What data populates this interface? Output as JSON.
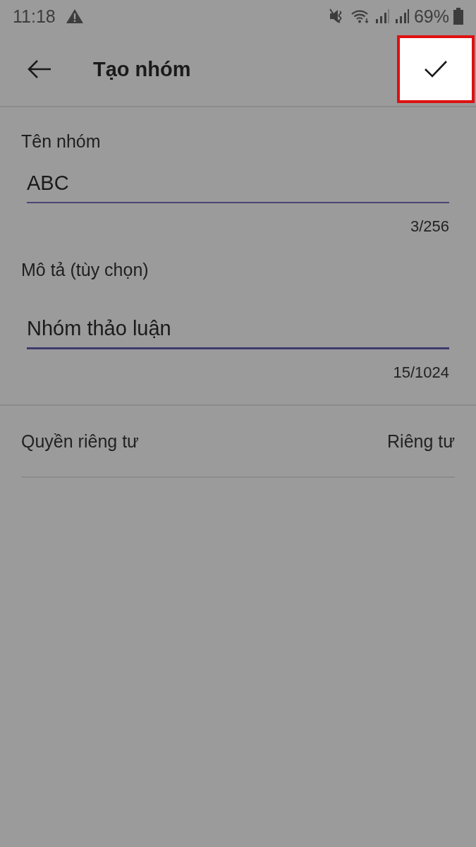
{
  "status_bar": {
    "time": "11:18",
    "battery": "69%"
  },
  "header": {
    "title": "Tạo nhóm",
    "done_button": {
      "highlighted": true
    }
  },
  "fields": [
    {
      "label": "Tên nhóm",
      "value": "ABC",
      "counter": "3/256",
      "focused": false
    },
    {
      "label": "Mô tả (tùy chọn)",
      "value": "Nhóm thảo luận",
      "counter": "15/1024",
      "focused": true
    }
  ],
  "privacy": {
    "label": "Quyền riêng tư",
    "value": "Riêng tư"
  }
}
